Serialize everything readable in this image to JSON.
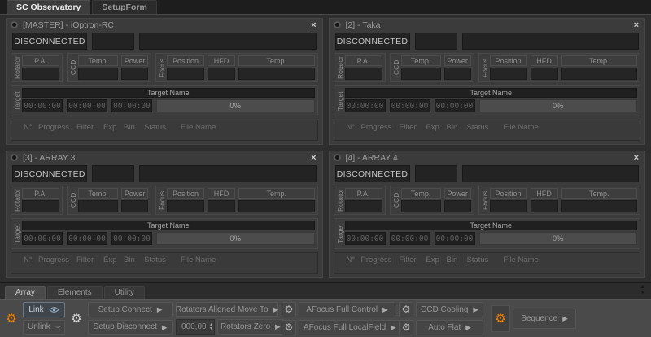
{
  "window": {
    "top_tabs": [
      {
        "label": "SC Observatory",
        "selected": true
      },
      {
        "label": "SetupForm",
        "selected": false
      }
    ],
    "bottom_tabs": [
      {
        "label": "Array",
        "selected": true
      },
      {
        "label": "Elements",
        "selected": false
      },
      {
        "label": "Utility",
        "selected": false
      }
    ]
  },
  "labels": {
    "rotator": "Rotator",
    "ccd": "CCD",
    "focus": "Focus",
    "target": "Target",
    "pa": "P.A.",
    "temp": "Temp.",
    "power": "Power",
    "position": "Position",
    "hfd": "HFD",
    "target_name": "Target Name",
    "grid_columns": [
      "N°",
      "Progress",
      "Filter",
      "Exp",
      "Bin",
      "Status",
      "File Name"
    ]
  },
  "panels": [
    {
      "title": "[MASTER] - iOptron-RC",
      "status": "DISCONNECTED",
      "times": [
        "00:00:00",
        "00:00:00",
        "00:00:00"
      ],
      "progress": "0%"
    },
    {
      "title": "[2] - Taka",
      "status": "DISCONNECTED",
      "times": [
        "00:00:00",
        "00:00:00",
        "00:00:00"
      ],
      "progress": "0%"
    },
    {
      "title": "[3] - ARRAY 3",
      "status": "DISCONNECTED",
      "times": [
        "00:00:00",
        "00:00:00",
        "00:00:00"
      ],
      "progress": "0%"
    },
    {
      "title": "[4] - ARRAY 4",
      "status": "DISCONNECTED",
      "times": [
        "00:00:00",
        "00:00:00",
        "00:00:00"
      ],
      "progress": "0%"
    }
  ],
  "toolbar": {
    "link": "Link",
    "unlink": "Unlink",
    "setup_connect": "Setup Connect",
    "setup_disconnect": "Setup Disconnect",
    "rotators_aligned_move_to": "Rotators Aligned Move To",
    "rotator_angle_value": "000,00",
    "rotators_zero": "Rotators Zero",
    "afocus_full_control": "AFocus Full Control",
    "afocus_full_localfield": "AFocus Full LocalField",
    "ccd_cooling": "CCD Cooling",
    "auto_flat": "Auto Flat",
    "sequence": "Sequence"
  },
  "icons": {
    "gear": "⚙",
    "play": "▶",
    "close": "×",
    "collapse_up": "▲",
    "collapse_down": "▼",
    "spin_up": "▴",
    "spin_down": "▾"
  },
  "colors": {
    "accent_orange": "#e6820e",
    "panel_bg": "#3b3b3b",
    "field_bg": "#232323",
    "toolbar_bg": "#4a4a4a"
  }
}
